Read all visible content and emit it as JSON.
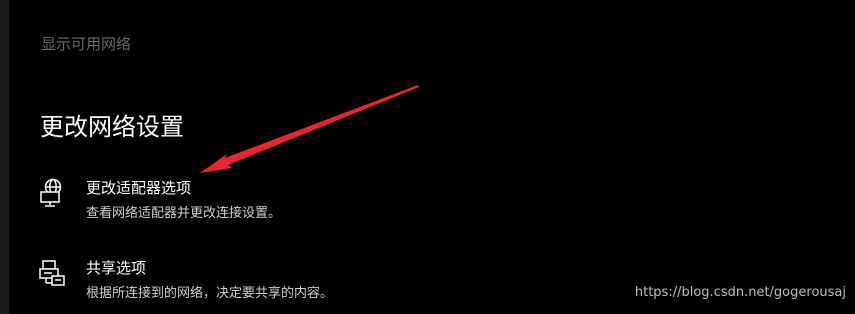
{
  "show_networks_link": "显示可用网络",
  "section_title": "更改网络设置",
  "options": [
    {
      "title": "更改适配器选项",
      "description": "查看网络适配器并更改连接设置。",
      "icon": "network-adapter-icon"
    },
    {
      "title": "共享选项",
      "description": "根据所连接到的网络，决定要共享的内容。",
      "icon": "sharing-icon"
    }
  ],
  "annotation_arrow_color": "#e8262d",
  "watermark": "https://blog.csdn.net/gogerousaj"
}
